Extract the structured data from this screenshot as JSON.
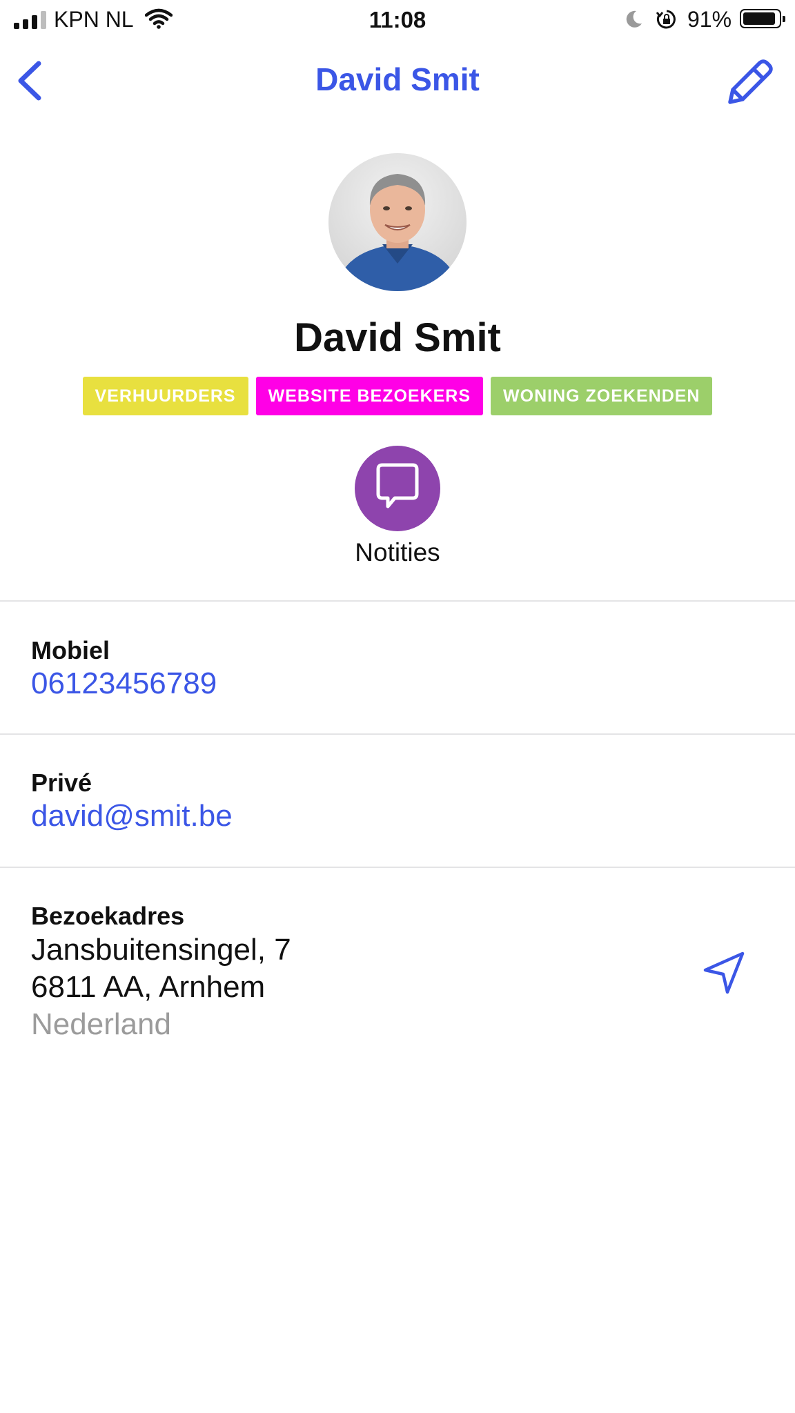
{
  "status_bar": {
    "carrier": "KPN NL",
    "time": "11:08",
    "battery_percent": "91%",
    "battery_level": 0.91,
    "signal_bars": 3,
    "icons": [
      "signal-icon",
      "wifi-icon",
      "moon-icon",
      "rotation-lock-icon",
      "battery-icon"
    ]
  },
  "nav": {
    "title": "David Smit",
    "back_icon": "chevron-left-icon",
    "edit_icon": "pencil-icon",
    "accent_color": "#3b56e6"
  },
  "contact": {
    "name": "David Smit",
    "tags": [
      {
        "label": "VERHUURDERS",
        "color": "#e8e03f"
      },
      {
        "label": "WEBSITE BEZOEKERS",
        "color": "#ff00e6"
      },
      {
        "label": "WONING ZOEKENDEN",
        "color": "#9ccf6a"
      }
    ],
    "action": {
      "label": "Notities",
      "icon": "speech-bubble-icon",
      "color": "#8e44ad"
    }
  },
  "details": {
    "mobile": {
      "label": "Mobiel",
      "value": "06123456789"
    },
    "private": {
      "label": "Privé",
      "value": "david@smit.be"
    },
    "address": {
      "label": "Bezoekadres",
      "street": "Jansbuitensingel, 7",
      "city": "6811 AA, Arnhem",
      "country": "Nederland",
      "icon": "location-arrow-icon"
    }
  }
}
